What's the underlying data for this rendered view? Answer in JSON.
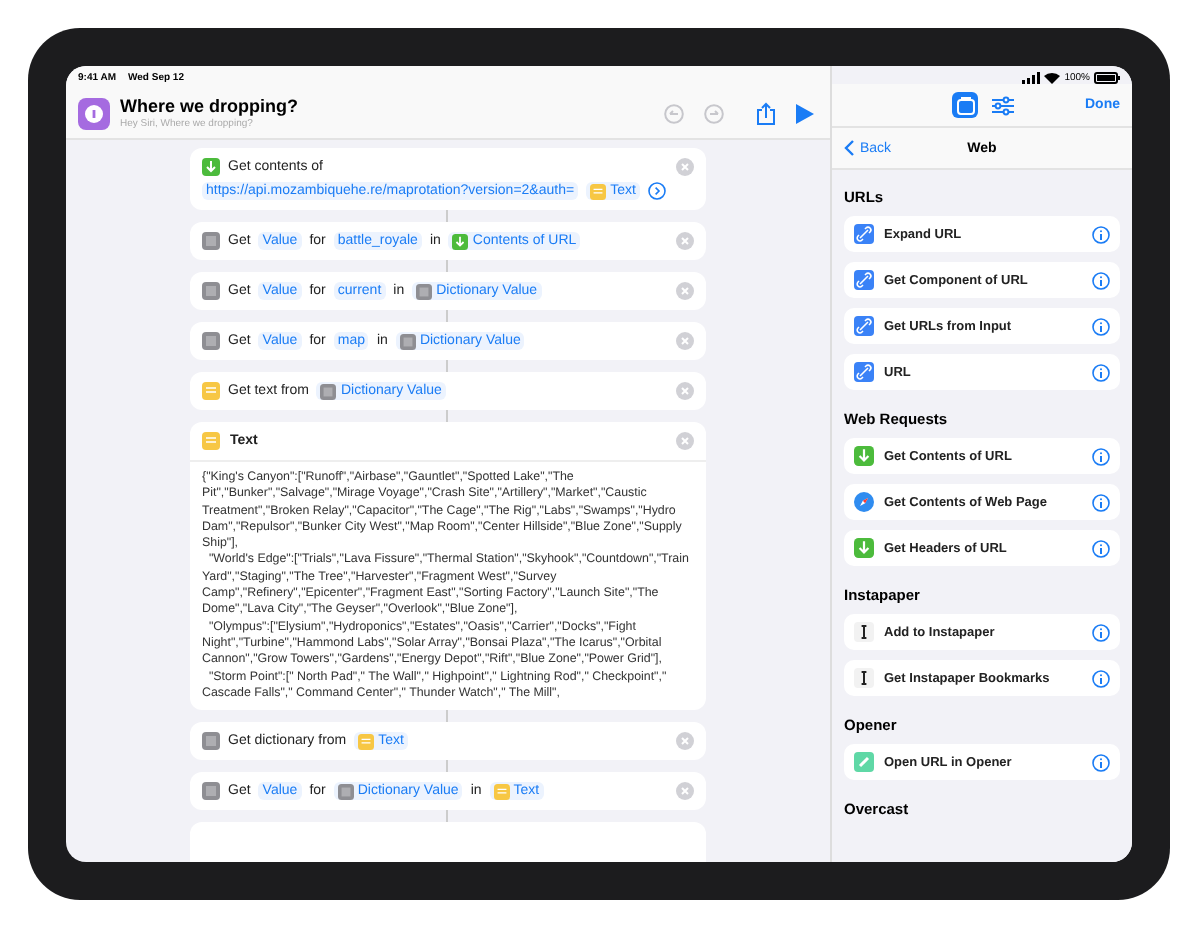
{
  "status_bar": {
    "time": "9:41 AM",
    "date": "Wed Sep 12",
    "battery": "100%"
  },
  "shortcut": {
    "title": "Where we dropping?",
    "subtitle": "Hey Siri, Where we dropping?"
  },
  "actions": [
    {
      "kind": "web",
      "tokens": [
        {
          "kind": "word",
          "text": "Get contents of"
        },
        {
          "kind": "param",
          "text": "https://api.mozambiquehe.re/maprotation?version=2&auth="
        },
        {
          "kind": "text_var",
          "text": "Text"
        },
        {
          "kind": "more"
        }
      ]
    },
    {
      "kind": "dictionary",
      "tokens": [
        {
          "kind": "word",
          "text": "Get"
        },
        {
          "kind": "param",
          "text": "Value"
        },
        {
          "kind": "word",
          "text": "for"
        },
        {
          "kind": "param",
          "text": "battle_royale"
        },
        {
          "kind": "word",
          "text": "in"
        },
        {
          "kind": "web_var",
          "text": "Contents of URL"
        }
      ]
    },
    {
      "kind": "dictionary",
      "tokens": [
        {
          "kind": "word",
          "text": "Get"
        },
        {
          "kind": "param",
          "text": "Value"
        },
        {
          "kind": "word",
          "text": "for"
        },
        {
          "kind": "param",
          "text": "current"
        },
        {
          "kind": "word",
          "text": "in"
        },
        {
          "kind": "dict_var",
          "text": "Dictionary Value"
        }
      ]
    },
    {
      "kind": "dictionary",
      "tokens": [
        {
          "kind": "word",
          "text": "Get"
        },
        {
          "kind": "param",
          "text": "Value"
        },
        {
          "kind": "word",
          "text": "for"
        },
        {
          "kind": "param",
          "text": "map"
        },
        {
          "kind": "word",
          "text": "in"
        },
        {
          "kind": "dict_var",
          "text": "Dictionary Value"
        }
      ]
    },
    {
      "kind": "text",
      "tokens": [
        {
          "kind": "word",
          "text": "Get text from"
        },
        {
          "kind": "dict_var",
          "text": "Dictionary Value"
        }
      ]
    },
    {
      "kind": "text",
      "title": "Text",
      "body": "{\"King's Canyon\":[\"Runoff\",\"Airbase\",\"Gauntlet\",\"Spotted Lake\",\"The Pit\",\"Bunker\",\"Salvage\",\"Mirage Voyage\",\"Crash Site\",\"Artillery\",\"Market\",\"Caustic Treatment\",\"Broken Relay\",\"Capacitor\",\"The Cage\",\"The Rig\",\"Labs\",\"Swamps\",\"Hydro Dam\",\"Repulsor\",\"Bunker City West\",\"Map Room\",\"Center Hillside\",\"Blue Zone\",\"Supply Ship\"],\n  \"World's Edge\":[\"Trials\",\"Lava Fissure\",\"Thermal Station\",\"Skyhook\",\"Countdown\",\"Train Yard\",\"Staging\",\"The Tree\",\"Harvester\",\"Fragment West\",\"Survey Camp\",\"Refinery\",\"Epicenter\",\"Fragment East\",\"Sorting Factory\",\"Launch Site\",\"The Dome\",\"Lava City\",\"The Geyser\",\"Overlook\",\"Blue Zone\"],\n  \"Olympus\":[\"Elysium\",\"Hydroponics\",\"Estates\",\"Oasis\",\"Carrier\",\"Docks\",\"Fight Night\",\"Turbine\",\"Hammond Labs\",\"Solar Array\",\"Bonsai Plaza\",\"The Icarus\",\"Orbital Cannon\",\"Grow Towers\",\"Gardens\",\"Energy Depot\",\"Rift\",\"Blue Zone\",\"Power Grid\"],\n  \"Storm Point\":[\" North Pad\",\" The Wall\",\" Highpoint\",\" Lightning Rod\",\" Checkpoint\",\" Cascade Falls\",\" Command Center\",\" Thunder Watch\",\" The Mill\","
    },
    {
      "kind": "dictionary",
      "tokens": [
        {
          "kind": "word",
          "text": "Get dictionary from"
        },
        {
          "kind": "text_var",
          "text": "Text"
        }
      ]
    },
    {
      "kind": "dictionary",
      "tokens": [
        {
          "kind": "word",
          "text": "Get"
        },
        {
          "kind": "param",
          "text": "Value"
        },
        {
          "kind": "word",
          "text": "for"
        },
        {
          "kind": "dict_var",
          "text": "Dictionary Value"
        },
        {
          "kind": "word",
          "text": "in"
        },
        {
          "kind": "text_var",
          "text": "Text"
        }
      ]
    }
  ],
  "panel": {
    "tabs": [
      {
        "kind": "library",
        "selected": true
      },
      {
        "kind": "settings",
        "selected": false
      }
    ],
    "done": "Done",
    "back": "Back",
    "title": "Web",
    "sections": [
      {
        "title": "URLs",
        "items": [
          {
            "kind": "link",
            "label": "Expand URL"
          },
          {
            "kind": "link",
            "label": "Get Component of URL"
          },
          {
            "kind": "link",
            "label": "Get URLs from Input"
          },
          {
            "kind": "link",
            "label": "URL"
          }
        ]
      },
      {
        "title": "Web Requests",
        "items": [
          {
            "kind": "web",
            "label": "Get Contents of URL"
          },
          {
            "kind": "browser",
            "label": "Get Contents of Web Page"
          },
          {
            "kind": "web",
            "label": "Get Headers of URL"
          }
        ]
      },
      {
        "title": "Instapaper",
        "items": [
          {
            "kind": "instapaper",
            "label": "Add to Instapaper"
          },
          {
            "kind": "instapaper",
            "label": "Get Instapaper Bookmarks"
          }
        ]
      },
      {
        "title": "Opener",
        "items": [
          {
            "kind": "opener",
            "label": "Open URL in Opener"
          }
        ]
      },
      {
        "title": "Overcast"
      }
    ]
  }
}
